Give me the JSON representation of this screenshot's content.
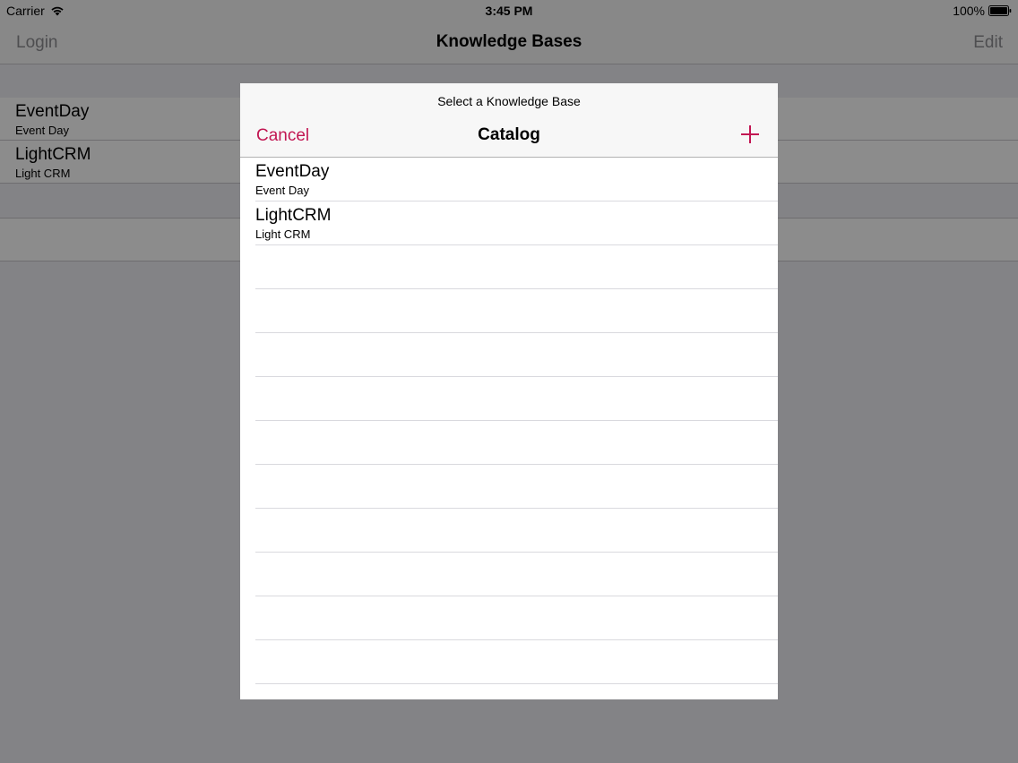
{
  "status_bar": {
    "carrier": "Carrier",
    "wifi_icon": "wifi-icon",
    "time": "3:45 PM",
    "battery": "100%",
    "battery_icon": "battery-icon"
  },
  "nav": {
    "left_label": "Login",
    "title": "Knowledge Bases",
    "right_label": "Edit"
  },
  "main_list": {
    "items": [
      {
        "title": "EventDay",
        "subtitle": "Event Day"
      },
      {
        "title": "LightCRM",
        "subtitle": "Light CRM"
      }
    ]
  },
  "modal": {
    "prompt": "Select a Knowledge Base",
    "cancel_label": "Cancel",
    "title": "Catalog",
    "add_icon": "plus-icon",
    "accent_color": "#c21652",
    "items": [
      {
        "title": "EventDay",
        "subtitle": "Event Day"
      },
      {
        "title": "LightCRM",
        "subtitle": "Light CRM"
      }
    ]
  }
}
